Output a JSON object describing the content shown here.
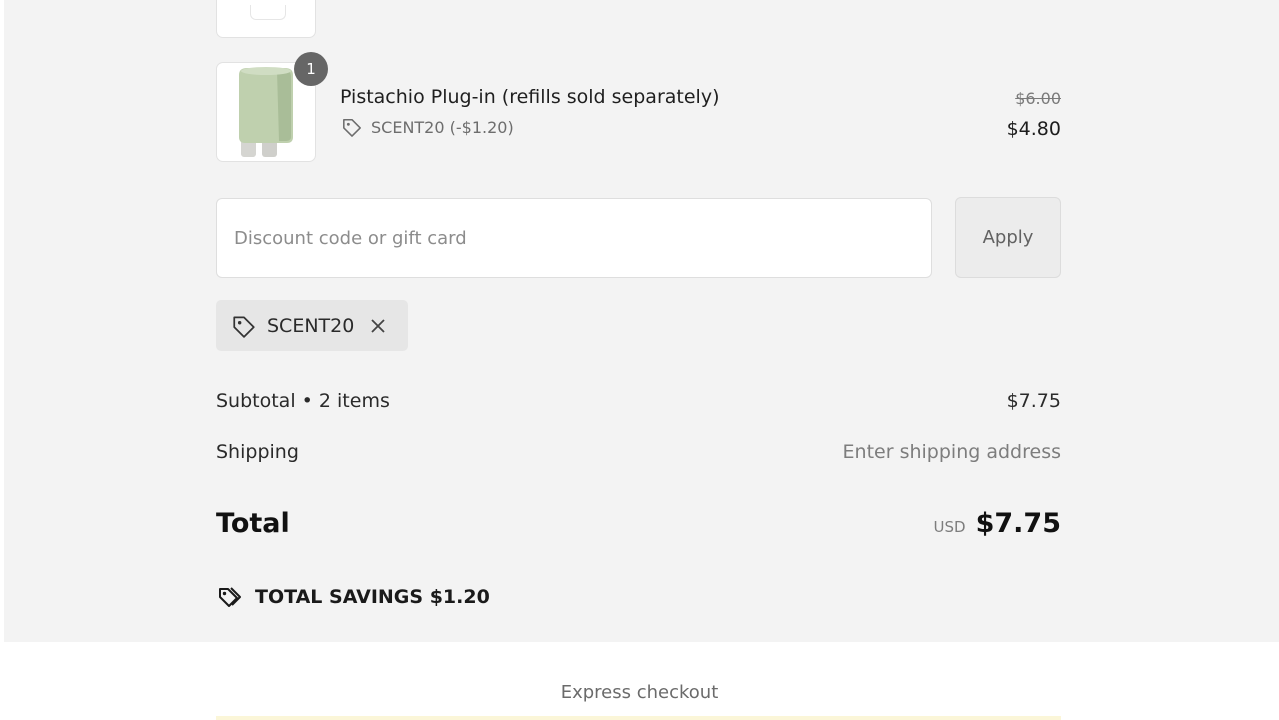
{
  "cart": {
    "items": [
      {
        "quantity": "1",
        "title": "Pistachio Plug-in (refills sold separately)",
        "discount_code_line": "SCENT20 (-$1.20)",
        "original_price": "$6.00",
        "price": "$4.80"
      }
    ]
  },
  "discount": {
    "placeholder": "Discount code or gift card",
    "apply_label": "Apply",
    "applied_code": "SCENT20"
  },
  "summary": {
    "subtotal_label": "Subtotal • 2 items",
    "subtotal_value": "$7.75",
    "shipping_label": "Shipping",
    "shipping_value": "Enter shipping address",
    "total_label": "Total",
    "currency": "USD",
    "total_value": "$7.75",
    "savings_text": "TOTAL SAVINGS $1.20"
  },
  "footer": {
    "express_checkout": "Express checkout"
  },
  "icons": {
    "tag": "tag-icon",
    "close": "close-icon",
    "savings": "savings-tag-icon"
  },
  "colors": {
    "summary_background": "#f3f3f3",
    "badge": "#666666",
    "muted_text": "#7d7d7d"
  }
}
